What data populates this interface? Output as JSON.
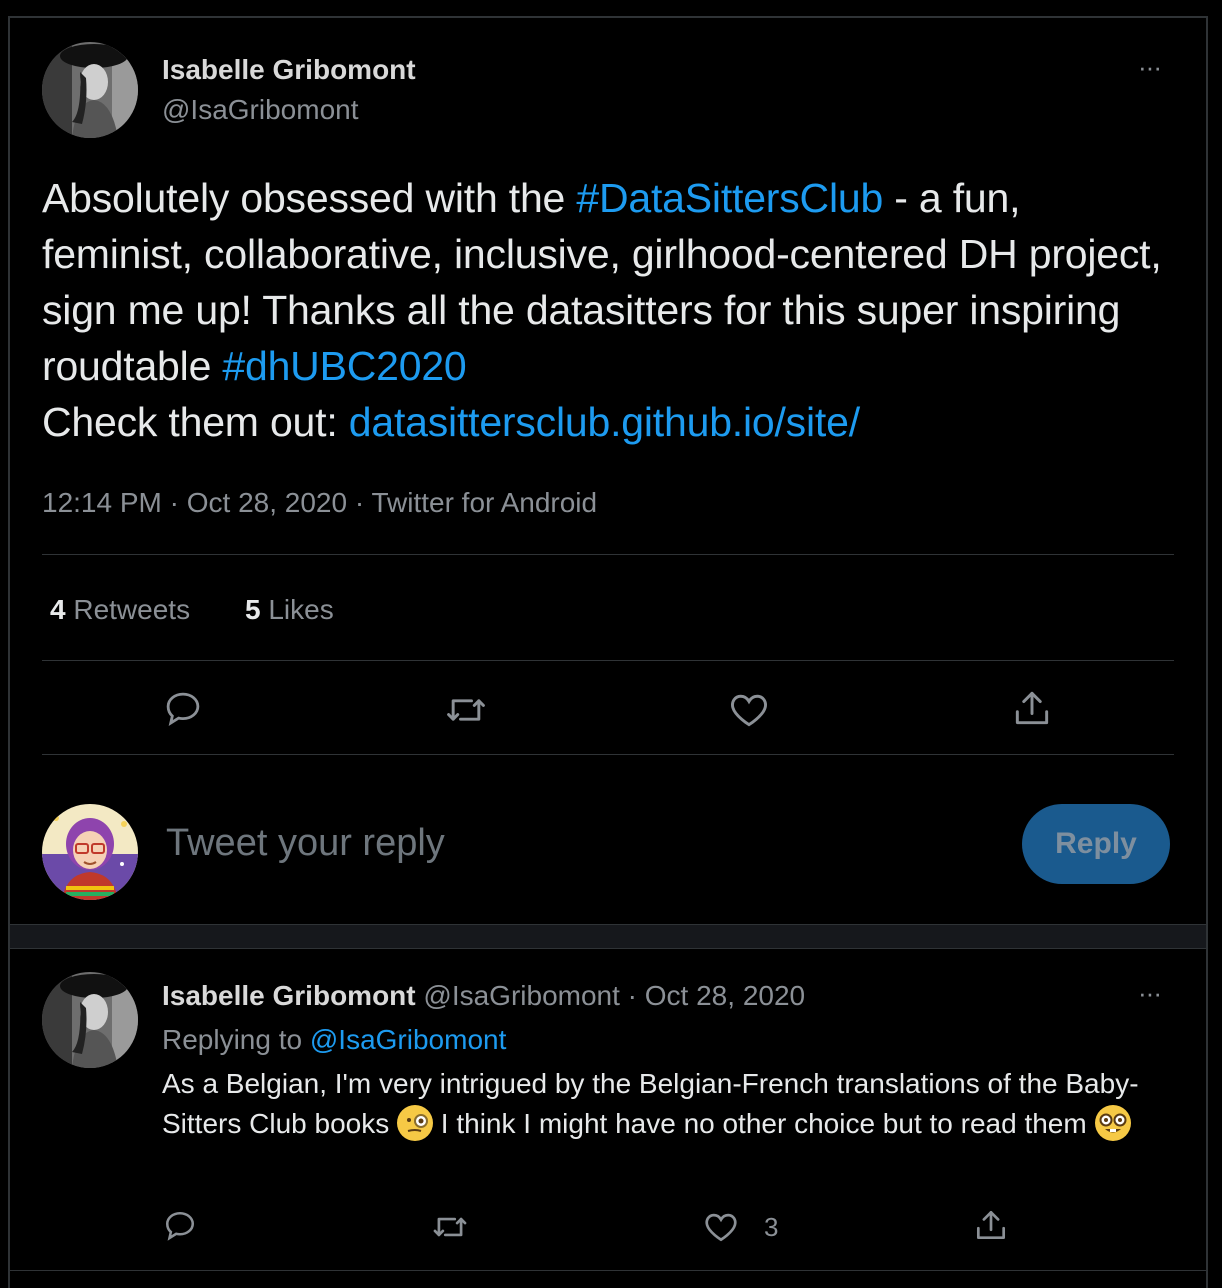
{
  "main_tweet": {
    "author_name": "Isabelle Gribomont",
    "author_handle": "@IsaGribomont",
    "more_label": "···",
    "text_part1": "Absolutely obsessed with the ",
    "hashtag1": "#DataSittersClub",
    "text_part2": " - a fun, feminist, collaborative, inclusive, girlhood-centered DH project, sign me up! Thanks all the datasitters for this super inspiring roudtable ",
    "hashtag2": "#dhUBC2020",
    "text_part3": "Check them out: ",
    "link": "datasittersclub.github.io/site/",
    "timestamp": "12:14 PM · Oct 28, 2020 · Twitter for Android",
    "retweets_count": "4",
    "retweets_label": "Retweets",
    "likes_count": "5",
    "likes_label": "Likes"
  },
  "reply_box": {
    "placeholder": "Tweet your reply",
    "button_label": "Reply"
  },
  "reply_tweet": {
    "author_name": "Isabelle Gribomont",
    "author_handle": "@IsaGribomont",
    "date": "· Oct 28, 2020",
    "more_label": "···",
    "replying_to_label": "Replying to",
    "replying_to_handle": "@IsaGribomont",
    "text_part1": "As a Belgian, I'm very intrigued by the Belgian-French translations of the Baby-Sitters Club books ",
    "text_part2": " I think I might have no other choice but to read them ",
    "like_count": "3"
  },
  "colors": {
    "background": "#000000",
    "link": "#1d9bf0",
    "muted": "#8b9096",
    "reply_button": "#1a5a8e"
  }
}
